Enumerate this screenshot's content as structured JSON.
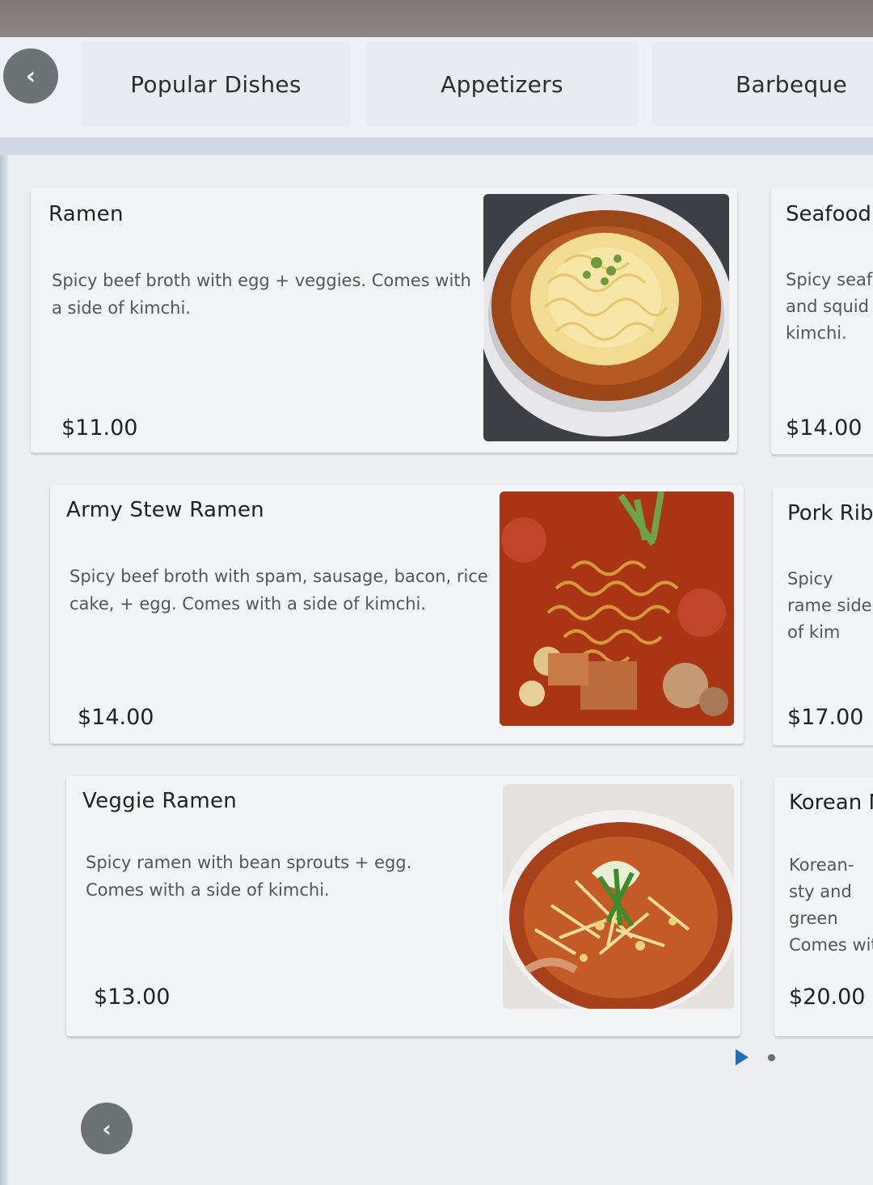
{
  "tabs": [
    {
      "label": "Popular Dishes"
    },
    {
      "label": "Appetizers"
    },
    {
      "label": "Barbeque"
    }
  ],
  "menu_items": [
    {
      "name": "Ramen",
      "description": "Spicy beef broth with egg + veggies. Comes with a side of kimchi.",
      "price": "$11.00",
      "image": "ramen-bowl-photo"
    },
    {
      "name": "Army Stew Ramen",
      "description": "Spicy beef broth with spam, sausage, bacon, rice cake, + egg. Comes with a side of kimchi.",
      "price": "$14.00",
      "image": "army-stew-photo"
    },
    {
      "name": "Veggie Ramen",
      "description": "Spicy ramen with bean sprouts + egg. Comes with a side of kimchi.",
      "price": "$13.00",
      "image": "veggie-ramen-photo"
    }
  ],
  "side_items": [
    {
      "name": "Seafood",
      "description": "Spicy seaf and squid kimchi.",
      "price": "$14.00"
    },
    {
      "name": "Pork Rib",
      "description": "Spicy rame side of kim",
      "price": "$17.00"
    },
    {
      "name": "Korean N",
      "description": "Korean-sty and green Comes wit",
      "price": "$20.00"
    }
  ],
  "colors": {
    "accent": "#1e6fb8",
    "back_button": "#6d7275",
    "card_bg": "#f3f4f6"
  },
  "icons": {
    "back": "chevron-left-icon",
    "pager_current": "play-arrow-icon",
    "pager_other": "dot-icon"
  },
  "glyphs": {
    "chevron_left": "‹"
  }
}
